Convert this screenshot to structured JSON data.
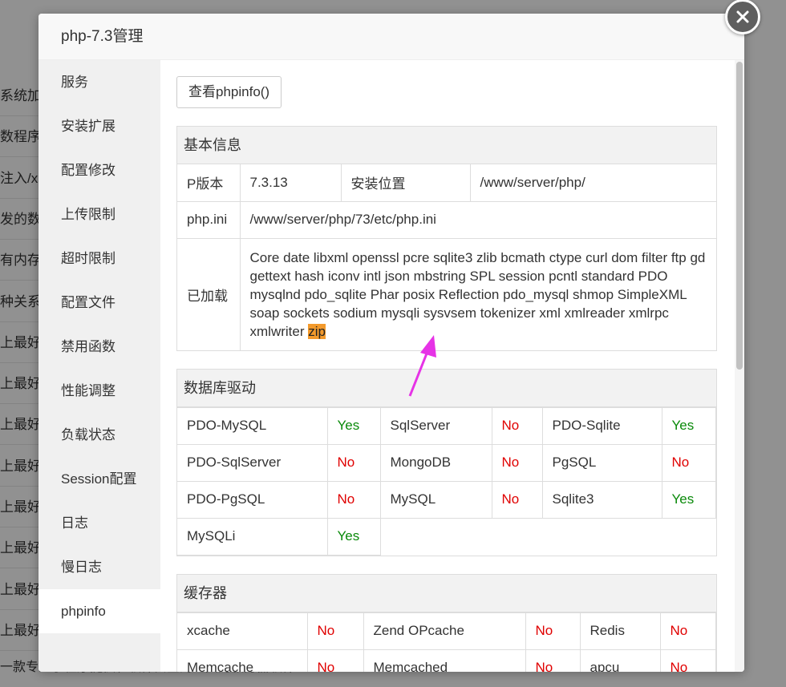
{
  "background": {
    "rows": [
      "系统加固",
      "数程序,可",
      "注入/xs",
      "发的数",
      "有内存ど",
      "种关系",
      "上最好的",
      "上最好的",
      "上最好的",
      "上最好的",
      "上最好的",
      "上最好的",
      "上最好的",
      "上最好的"
    ],
    "footer": "一款专注于程序提供和软件安全的免费的服务器软件"
  },
  "dialog": {
    "title": "php-7.3管理"
  },
  "sidebar": {
    "items": [
      {
        "label": "服务"
      },
      {
        "label": "安装扩展"
      },
      {
        "label": "配置修改"
      },
      {
        "label": "上传限制"
      },
      {
        "label": "超时限制"
      },
      {
        "label": "配置文件"
      },
      {
        "label": "禁用函数"
      },
      {
        "label": "性能调整"
      },
      {
        "label": "负载状态"
      },
      {
        "label": "Session配置"
      },
      {
        "label": "日志"
      },
      {
        "label": "慢日志"
      },
      {
        "label": "phpinfo"
      }
    ],
    "active_index": 12
  },
  "main": {
    "phpinfo_button": "查看phpinfo()",
    "basic": {
      "title": "基本信息",
      "version_label": "P版本",
      "version_value": "7.3.13",
      "install_label": "安装位置",
      "install_value": "/www/server/php/",
      "ini_label": "php.ini",
      "ini_value": "/www/server/php/73/etc/php.ini",
      "loaded_label": "已加载",
      "loaded_value": "Core date libxml openssl pcre sqlite3 zlib bcmath ctype curl dom filter ftp gd gettext hash iconv intl json mbstring SPL session pcntl standard PDO mysqlnd pdo_sqlite Phar posix Reflection pdo_mysql shmop SimpleXML soap sockets sodium mysqli sysvsem tokenizer xml xmlreader xmlrpc xmlwriter",
      "highlight": "zip"
    },
    "db": {
      "title": "数据库驱动",
      "rows": [
        [
          {
            "name": "PDO-MySQL",
            "status": "Yes"
          },
          {
            "name": "SqlServer",
            "status": "No"
          },
          {
            "name": "PDO-Sqlite",
            "status": "Yes"
          }
        ],
        [
          {
            "name": "PDO-SqlServer",
            "status": "No"
          },
          {
            "name": "MongoDB",
            "status": "No"
          },
          {
            "name": "PgSQL",
            "status": "No"
          }
        ],
        [
          {
            "name": "PDO-PgSQL",
            "status": "No"
          },
          {
            "name": "MySQL",
            "status": "No"
          },
          {
            "name": "Sqlite3",
            "status": "Yes"
          }
        ],
        [
          {
            "name": "MySQLi",
            "status": "Yes"
          }
        ]
      ]
    },
    "cache": {
      "title": "缓存器",
      "rows": [
        [
          {
            "name": "xcache",
            "status": "No"
          },
          {
            "name": "Zend OPcache",
            "status": "No"
          },
          {
            "name": "Redis",
            "status": "No"
          }
        ],
        [
          {
            "name": "Memcache",
            "status": "No"
          },
          {
            "name": "Memcached",
            "status": "No"
          },
          {
            "name": "apcu",
            "status": "No"
          }
        ]
      ]
    }
  },
  "colors": {
    "yes": "#0a8a0a",
    "no": "#e00000",
    "highlight": "#f39a2c",
    "annotation_arrow": "#e633e6"
  }
}
